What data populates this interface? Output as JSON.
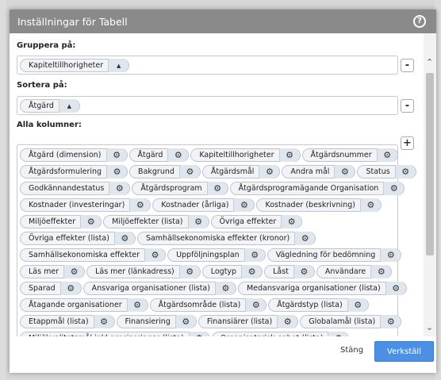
{
  "dialog": {
    "title": "Inställningar för Tabell",
    "help_icon": "?"
  },
  "group": {
    "label": "Gruppera på:",
    "pills": [
      {
        "text": "Kapiteltillhorigheter"
      }
    ],
    "remove_button": "-"
  },
  "sort": {
    "label": "Sortera på:",
    "pills": [
      {
        "text": "Åtgärd"
      }
    ],
    "remove_button": "-"
  },
  "columns": {
    "label": "Alla kolumner:",
    "add_button": "+",
    "rows": [
      [
        "Åtgärd (dimension)",
        "Åtgärd",
        "Kapiteltillhorigheter",
        "Åtgärdsnummer"
      ],
      [
        "Åtgärdsformulering",
        "Bakgrund",
        "Åtgärdsmål",
        "Andra mål",
        "Status"
      ],
      [
        "Godkännandestatus",
        "Åtgärdsprogram",
        "Åtgärdsprogramägande Organisation"
      ],
      [
        "Kostnader (investeringar)",
        "Kostnader (årliga)",
        "Kostnader (beskrivning)"
      ],
      [
        "Miljöeffekter",
        "Miljöeffekter (lista)",
        "Övriga effekter"
      ],
      [
        "Övriga effekter (lista)",
        "Samhällsekonomiska effekter (kronor)"
      ],
      [
        "Samhällsekonomiska effekter",
        "Uppföljningsplan",
        "Vägledning för bedömning"
      ],
      [
        "Läs mer",
        "Läs mer (länkadress)",
        "Logtyp",
        "Låst",
        "Användare"
      ],
      [
        "Sparad",
        "Ansvariga organisationer (lista)",
        "Medansvariga organisationer (lista)"
      ],
      [
        "Åtagande organisationer",
        "Åtgärdsområde (lista)",
        "Åtgärdstyp (lista)"
      ],
      [
        "Etappmål (lista)",
        "Finansiering",
        "Finansiärer (lista)",
        "Globalamål (lista)"
      ],
      [
        "Miljökvalitetsmål inkl preciseringar (lista)",
        "Organisatorisk enhet (lista)"
      ]
    ]
  },
  "footer": {
    "close_label": "Stäng",
    "apply_label": "Verkställ"
  },
  "colors": {
    "titlebar": "#8a8a8a",
    "apply_button": "#4d8fe3",
    "pill_bg": "#f1f3f6"
  },
  "icons": {
    "settings": "gear-icon",
    "sort": "sort-up-icon",
    "help": "help-icon"
  }
}
